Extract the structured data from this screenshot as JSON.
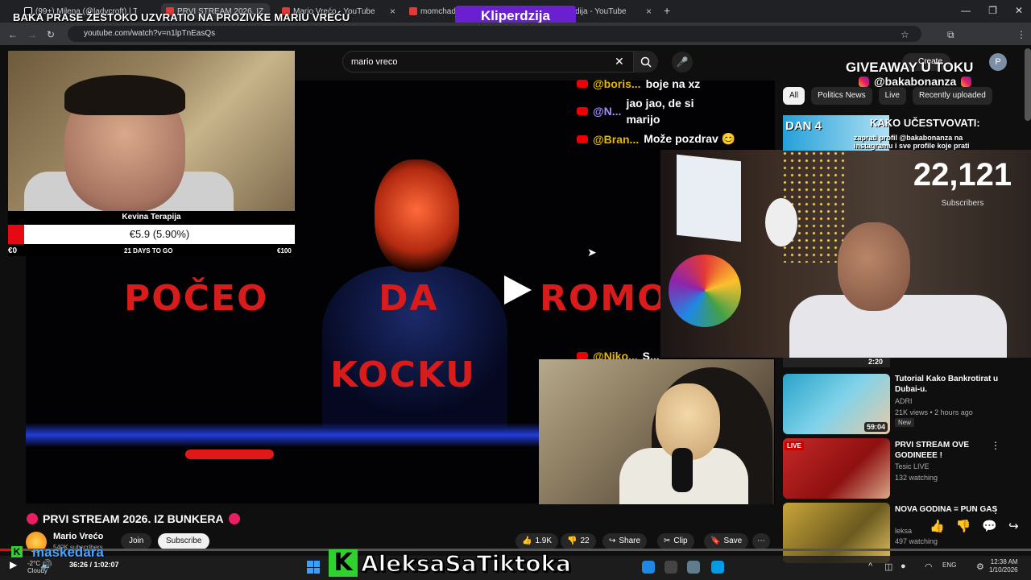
{
  "overlay": {
    "stream_title": "BAKA PRASE ŽESTOKO UZVRATIO NA PROZIVKE MARIU VREĆU",
    "kliper_label": "Kliperdzija",
    "giveaway": "GIVEAWAY U TOKU",
    "ig_handle": "@bakabonanza",
    "subscriber_count": "22,121",
    "subscriber_label": "Subscribers",
    "banner_day": "DAN 4",
    "banner_kako": "KAKO UČESTVOVATI:",
    "banner_sub": "zaprati profil @bakabonanza na instagramu i sve profile koje prati",
    "aleksa_badge": "K",
    "aleksa_text": "AleksaSaTiktoka",
    "masked_badge": "K",
    "masked_text": "maskedara"
  },
  "browser": {
    "tabs": [
      {
        "label": "(99+) Milena (@ladycroft) | Tik"
      },
      {
        "label": "PRVI STREAM 2026. IZ"
      },
      {
        "label": "Mario Vrećo - YouTube"
      },
      {
        "label": "momchadij"
      },
      {
        "label": "dija - YouTube"
      }
    ],
    "url": "youtube.com/watch?v=n1lpTnEasQs",
    "new_tab": "+",
    "close": "×"
  },
  "youtube": {
    "search_value": "mario vreco",
    "create_label": "Create",
    "chips": [
      {
        "label": "All",
        "active": true
      },
      {
        "label": "Politics News",
        "active": false
      },
      {
        "label": "Live",
        "active": false
      },
      {
        "label": "Recently uploaded",
        "active": false
      }
    ],
    "video_title": "PRVI STREAM 2026. IZ BUNKERA",
    "channel_name": "Mario Vrećo",
    "channel_subs": "540K subscribers",
    "join": "Join",
    "subscribe": "Subscribe",
    "likes": "1.9K",
    "dislikes": "22",
    "share": "Share",
    "clip": "Clip",
    "save": "Save",
    "time": "36:26 / 1:02:07"
  },
  "donation": {
    "title": "Kevina Terapija",
    "current": "€5.9 (5.90%)",
    "min": "€0",
    "days": "21 DAYS TO GO",
    "max": "€100",
    "progress_pct": 5.9
  },
  "video_text": {
    "word1": "POČEO",
    "word2": "DA",
    "word3": "ROMO",
    "word4": "KOCKU"
  },
  "chat": [
    {
      "user": "@boris...",
      "msg": "boje na xz",
      "color": "y"
    },
    {
      "user": "@N...",
      "msg": "jao jao, de si marijo",
      "color": "p"
    },
    {
      "user": "@Bran...",
      "msg": "Može pozdrav 😊",
      "color": "y"
    },
    {
      "user": "@Niko...",
      "msg": "S...",
      "color": "y"
    }
  ],
  "recommendations": [
    {
      "duration": "2:20"
    },
    {
      "title": "Tutorial Kako Bankrotirat u Dubai-u.",
      "channel": "ADRI",
      "meta": "21K views • 2 hours ago",
      "badge": "New",
      "duration": "59:04"
    },
    {
      "title": "PRVI STREAM OVE GODINEEE !",
      "channel": "Tesic LIVE",
      "meta": "132 watching",
      "badge": "LIVE"
    },
    {
      "title": "NOVA GODINA = PUN GAS",
      "channel": "leksa",
      "meta": "497 watching",
      "badge": "LIVE"
    }
  ],
  "taskbar": {
    "weather_temp": "-2°C",
    "weather_desc": "Cloudy",
    "lang": "ENG",
    "time": "12:38 AM",
    "date": "1/10/2026"
  },
  "colors": {
    "bg": "#0f0f0f",
    "accent_red": "#ff0000",
    "kliper_purple": "#6a1fd1",
    "video_red": "#d81b1b"
  }
}
